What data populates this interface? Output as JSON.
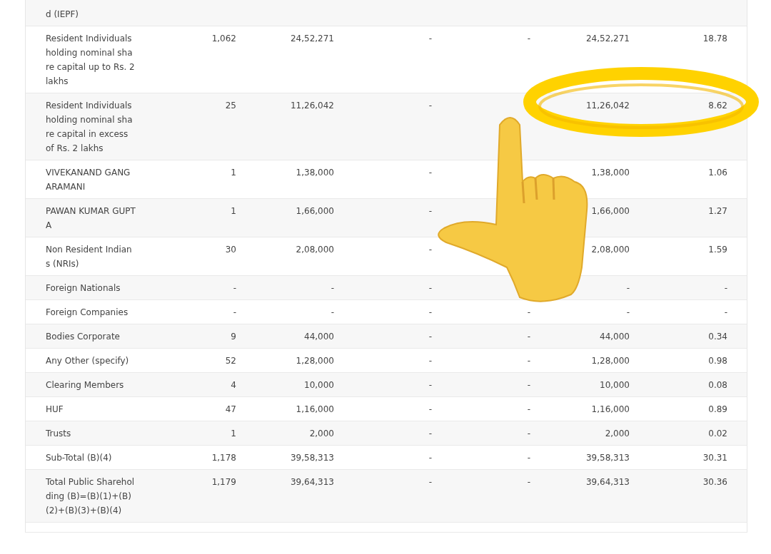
{
  "table": {
    "rows": [
      {
        "cells": [
          "d (IEPF)",
          "",
          "",
          "",
          "",
          "",
          ""
        ]
      },
      {
        "cells": [
          "Resident Individuals holding nominal share capital up to Rs. 2 lakhs",
          "1,062",
          "24,52,271",
          "-",
          "-",
          "24,52,271",
          "18.78"
        ]
      },
      {
        "cells": [
          "Resident Individuals holding nominal share capital in excess of Rs. 2 lakhs",
          "25",
          "11,26,042",
          "-",
          "",
          "11,26,042",
          "8.62"
        ]
      },
      {
        "cells": [
          "VIVEKANAND GANGARAMANI",
          "1",
          "1,38,000",
          "-",
          "",
          "1,38,000",
          "1.06"
        ]
      },
      {
        "cells": [
          "PAWAN KUMAR GUPTA",
          "1",
          "1,66,000",
          "-",
          "",
          "1,66,000",
          "1.27"
        ]
      },
      {
        "cells": [
          "Non Resident Indians (NRIs)",
          "30",
          "2,08,000",
          "-",
          "",
          "2,08,000",
          "1.59"
        ]
      },
      {
        "cells": [
          "Foreign Nationals",
          "-",
          "-",
          "-",
          "",
          "-",
          "-"
        ]
      },
      {
        "cells": [
          "Foreign Companies",
          "-",
          "-",
          "-",
          "-",
          "-",
          "-"
        ]
      },
      {
        "cells": [
          "Bodies Corporate",
          "9",
          "44,000",
          "-",
          "-",
          "44,000",
          "0.34"
        ]
      },
      {
        "cells": [
          "Any Other (specify)",
          "52",
          "1,28,000",
          "-",
          "-",
          "1,28,000",
          "0.98"
        ]
      },
      {
        "cells": [
          "Clearing Members",
          "4",
          "10,000",
          "-",
          "-",
          "10,000",
          "0.08"
        ]
      },
      {
        "cells": [
          "HUF",
          "47",
          "1,16,000",
          "-",
          "-",
          "1,16,000",
          "0.89"
        ]
      },
      {
        "cells": [
          "Trusts",
          "1",
          "2,000",
          "-",
          "-",
          "2,000",
          "0.02"
        ]
      },
      {
        "cells": [
          "Sub-Total (B)(4)",
          "1,178",
          "39,58,313",
          "-",
          "-",
          "39,58,313",
          "30.31"
        ]
      },
      {
        "cells": [
          "Total Public Shareholding (B)=(B)(1)+(B)(2)+(B)(3)+(B)(4)",
          "1,179",
          "39,64,313",
          "-",
          "-",
          "39,64,313",
          "30.36"
        ]
      },
      {
        "cells": [
          "",
          "",
          "",
          "",
          "",
          "",
          ""
        ]
      }
    ]
  },
  "overlays": [
    {
      "kind": "halo"
    },
    {
      "kind": "hand"
    }
  ]
}
